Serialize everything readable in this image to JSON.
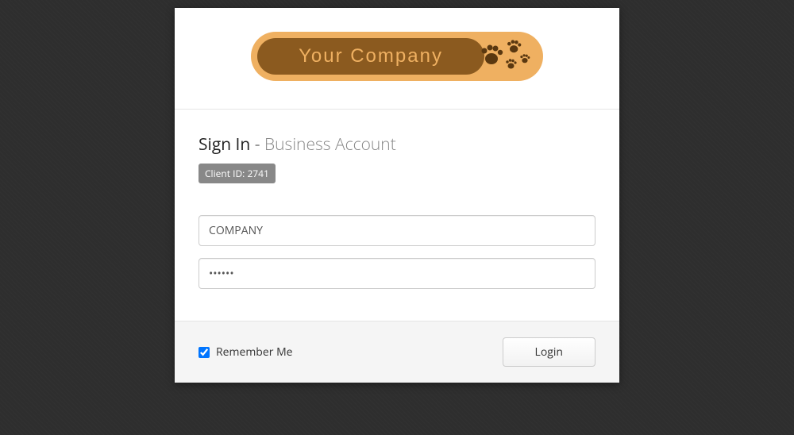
{
  "logo": {
    "text": "Your Company"
  },
  "heading": {
    "main": "Sign In",
    "separator": " - ",
    "sub": "Business Account"
  },
  "client_badge": "Client ID: 2741",
  "form": {
    "username_value": "COMPANY",
    "password_value": "••••••",
    "remember_label": "Remember Me",
    "remember_checked": true
  },
  "buttons": {
    "login": "Login"
  }
}
